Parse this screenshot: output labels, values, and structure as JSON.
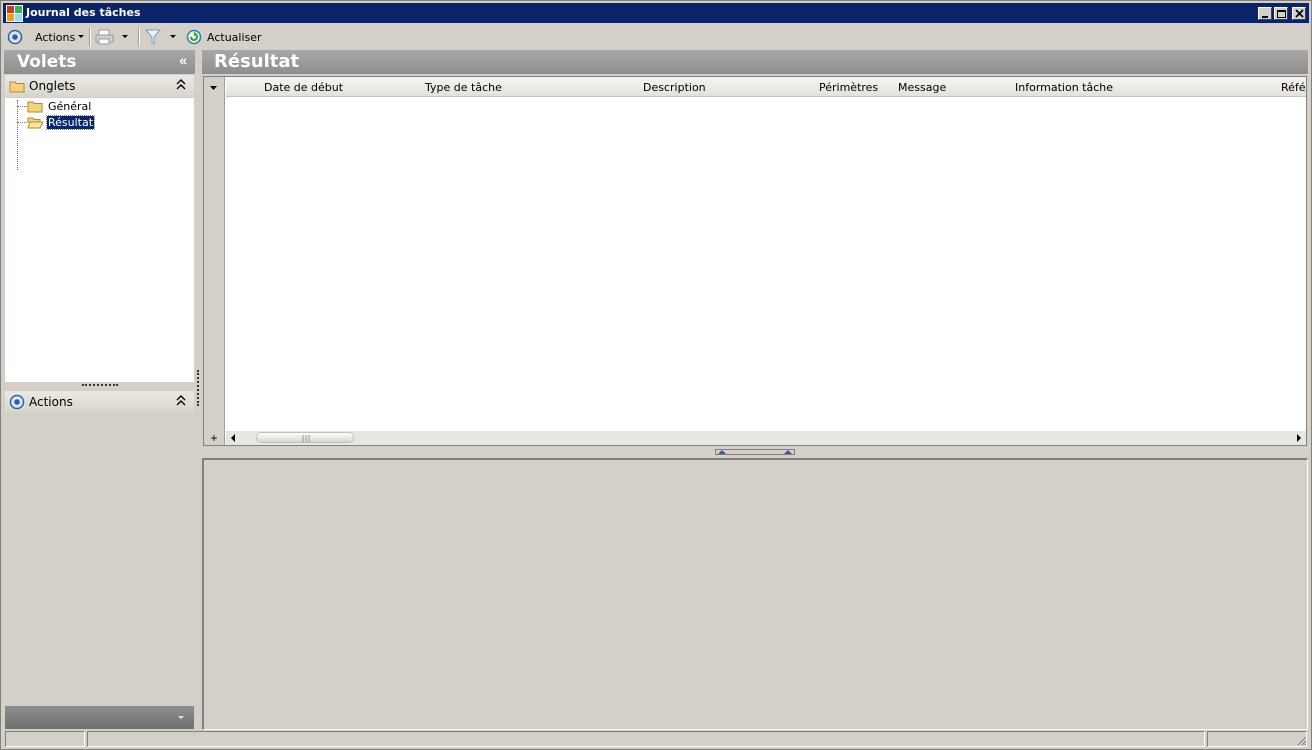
{
  "window": {
    "title": "Journal des tâches",
    "controls": [
      "minimize",
      "maximize",
      "close"
    ]
  },
  "toolbar": {
    "actions_label": "Actions",
    "refresh_label": "Actualiser",
    "icons": [
      "actions-icon",
      "print-icon",
      "filter-icon",
      "refresh-icon"
    ]
  },
  "left_panel": {
    "title": "Volets",
    "collapse_glyph": "«",
    "tabs_section": {
      "label": "Onglets",
      "items": [
        {
          "label": "Général",
          "selected": false
        },
        {
          "label": "Résultat",
          "selected": true
        }
      ]
    },
    "actions_section": {
      "label": "Actions"
    }
  },
  "right_panel": {
    "title": "Résultat",
    "grid": {
      "columns": [
        "Date de début",
        "Type de tâche",
        "Description",
        "Périmètres",
        "Message",
        "Information tâche",
        "Réfé"
      ],
      "rows": []
    }
  },
  "colors": {
    "titlebar": "#0a246a",
    "panel_header": "#8e8e8e",
    "face": "#d4d0c8",
    "selection": "#0a246a"
  }
}
